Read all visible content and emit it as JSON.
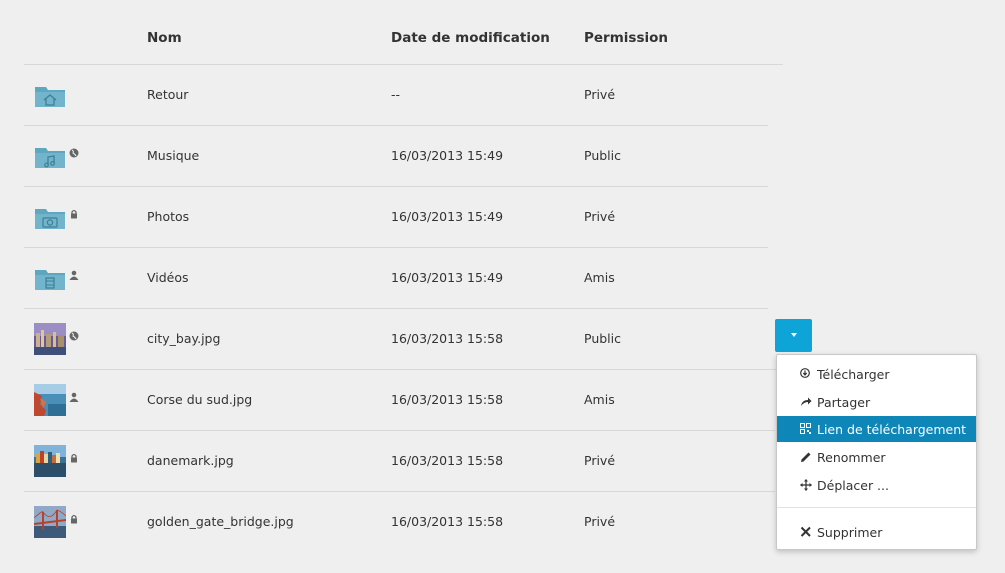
{
  "table": {
    "headers": {
      "name": "Nom",
      "date": "Date de modification",
      "permission": "Permission"
    },
    "rows": [
      {
        "name": "Retour",
        "date": "--",
        "permission": "Privé",
        "icon": "folder-home-icon",
        "perm_icon": ""
      },
      {
        "name": "Musique",
        "date": "16/03/2013 15:49",
        "permission": "Public",
        "icon": "folder-music-icon",
        "perm_icon": "globe-icon"
      },
      {
        "name": "Photos",
        "date": "16/03/2013 15:49",
        "permission": "Privé",
        "icon": "folder-camera-icon",
        "perm_icon": "lock-icon"
      },
      {
        "name": "Vidéos",
        "date": "16/03/2013 15:49",
        "permission": "Amis",
        "icon": "folder-film-icon",
        "perm_icon": "user-icon"
      },
      {
        "name": "city_bay.jpg",
        "date": "16/03/2013 15:58",
        "permission": "Public",
        "icon": "image-thumbnail-icon",
        "perm_icon": "globe-icon"
      },
      {
        "name": "Corse du sud.jpg",
        "date": "16/03/2013 15:58",
        "permission": "Amis",
        "icon": "image-thumbnail-icon",
        "perm_icon": "user-icon"
      },
      {
        "name": "danemark.jpg",
        "date": "16/03/2013 15:58",
        "permission": "Privé",
        "icon": "image-thumbnail-icon",
        "perm_icon": "lock-icon"
      },
      {
        "name": "golden_gate_bridge.jpg",
        "date": "16/03/2013 15:58",
        "permission": "Privé",
        "icon": "image-thumbnail-icon",
        "perm_icon": "lock-icon"
      }
    ]
  },
  "menu": {
    "items": [
      {
        "label": "Télécharger",
        "icon": "download-icon"
      },
      {
        "label": "Partager",
        "icon": "share-icon"
      },
      {
        "label": "Lien de téléchargement",
        "icon": "qr-link-icon"
      },
      {
        "label": "Renommer",
        "icon": "pencil-icon"
      },
      {
        "label": "Déplacer ...",
        "icon": "move-icon"
      },
      {
        "label": "Supprimer",
        "icon": "close-icon"
      }
    ]
  },
  "colors": {
    "background": "#efefef",
    "folder": "#5fa6bf",
    "accent_button": "#0fa4d8",
    "menu_highlight": "#0e86b8",
    "perm_icon": "#666666"
  }
}
